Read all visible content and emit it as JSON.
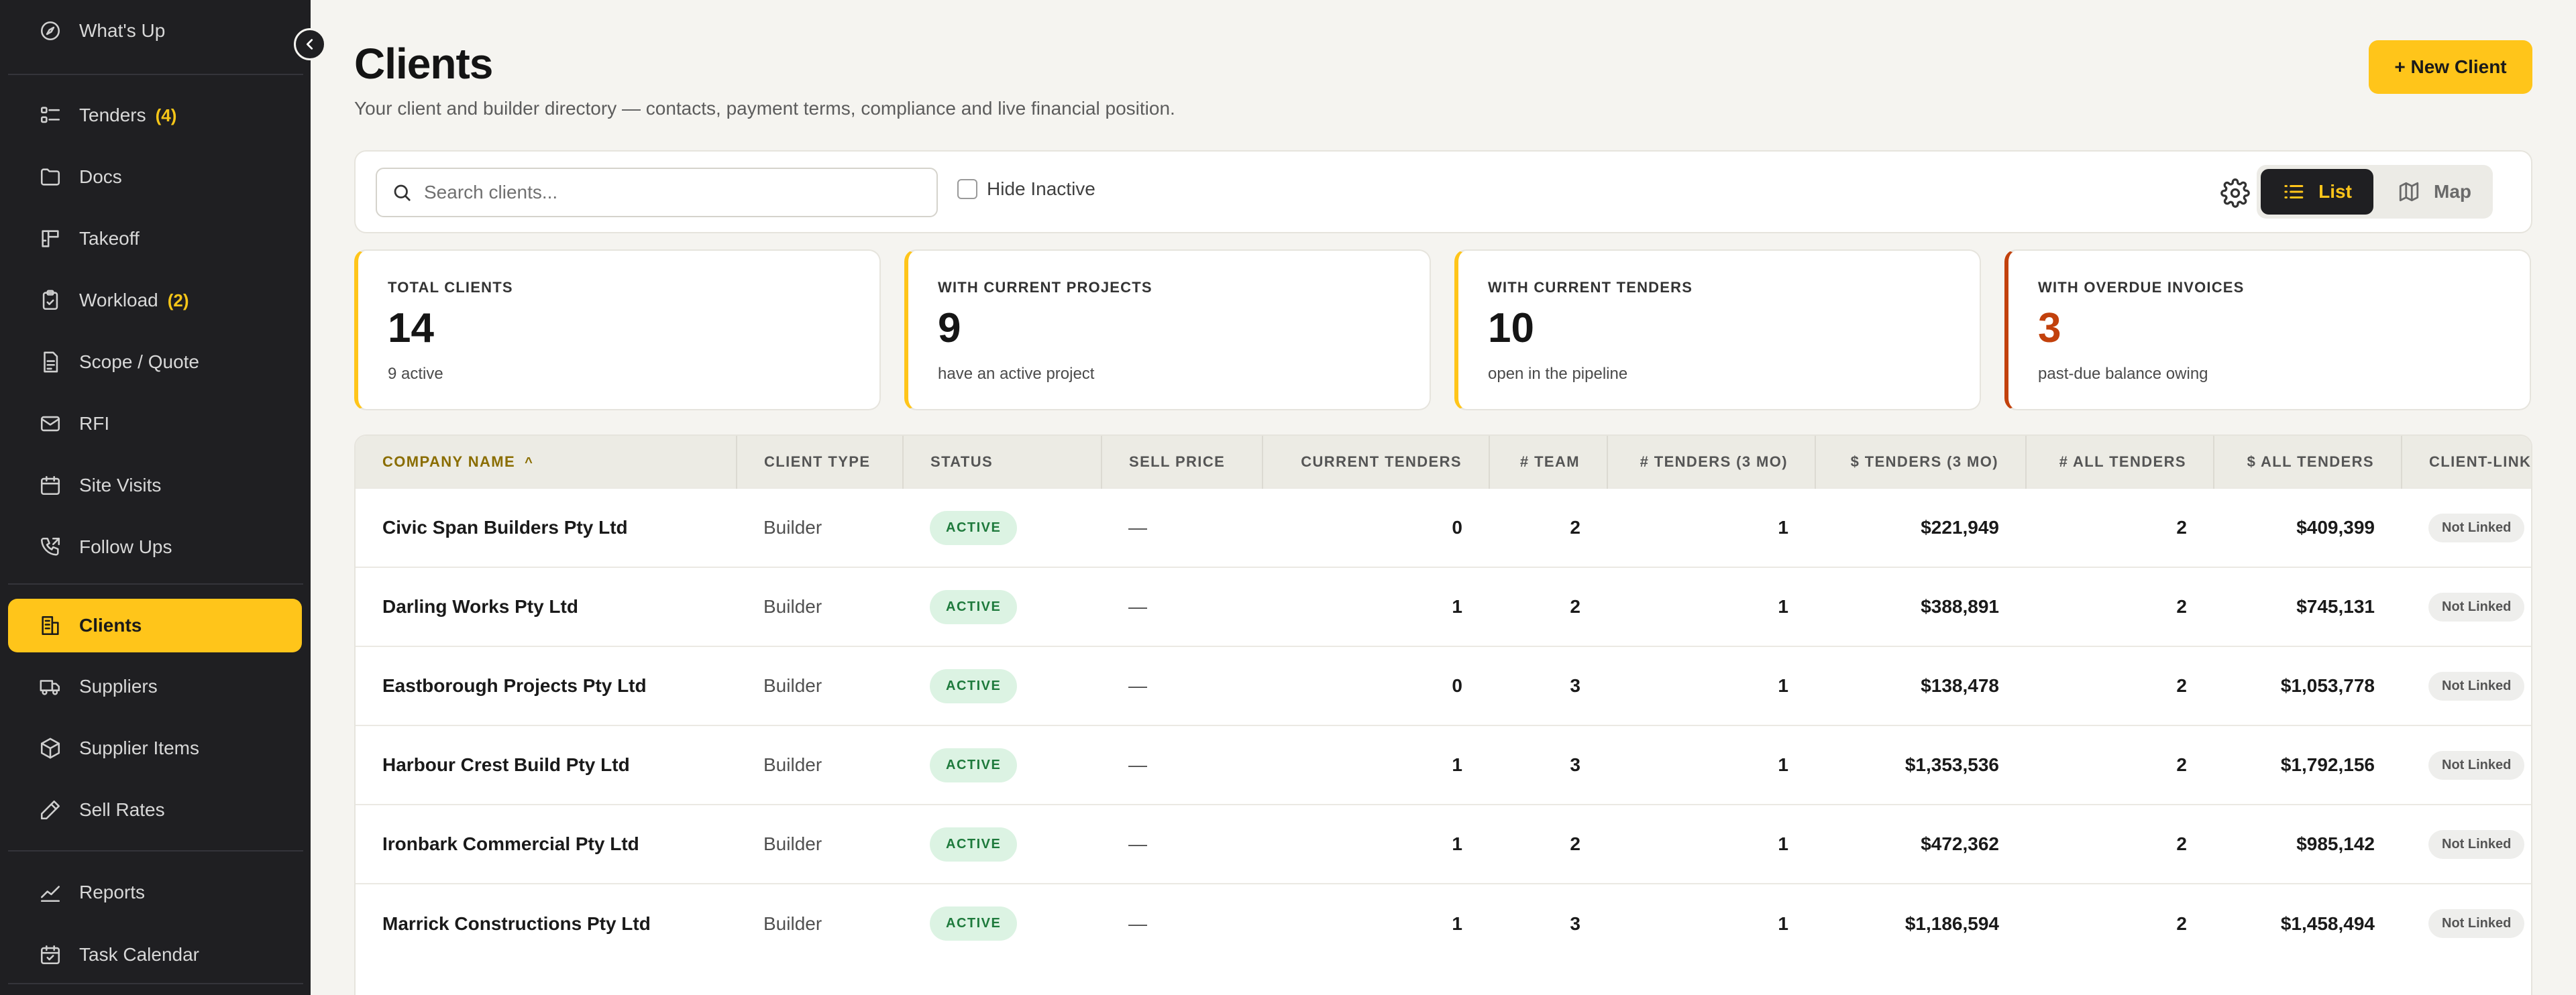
{
  "sidebar": {
    "items": [
      {
        "key": "whats-up",
        "label": "What's Up",
        "badge": "",
        "icon": "compass-icon"
      },
      {
        "key": "tenders",
        "label": "Tenders",
        "badge": "(4)",
        "icon": "list-icon"
      },
      {
        "key": "docs",
        "label": "Docs",
        "badge": "",
        "icon": "folder-icon"
      },
      {
        "key": "takeoff",
        "label": "Takeoff",
        "badge": "",
        "icon": "blueprint-icon"
      },
      {
        "key": "workload",
        "label": "Workload",
        "badge": "(2)",
        "icon": "clipboard-icon"
      },
      {
        "key": "scope-quote",
        "label": "Scope / Quote",
        "badge": "",
        "icon": "document-icon"
      },
      {
        "key": "rfi",
        "label": "RFI",
        "badge": "",
        "icon": "mail-icon"
      },
      {
        "key": "site-visits",
        "label": "Site Visits",
        "badge": "",
        "icon": "calendar-icon"
      },
      {
        "key": "follow-ups",
        "label": "Follow Ups",
        "badge": "",
        "icon": "phone-icon"
      },
      {
        "key": "clients",
        "label": "Clients",
        "badge": "",
        "icon": "building-icon"
      },
      {
        "key": "suppliers",
        "label": "Suppliers",
        "badge": "",
        "icon": "truck-icon"
      },
      {
        "key": "supplier-items",
        "label": "Supplier Items",
        "badge": "",
        "icon": "box-icon"
      },
      {
        "key": "sell-rates",
        "label": "Sell Rates",
        "badge": "",
        "icon": "pencil-icon"
      },
      {
        "key": "reports",
        "label": "Reports",
        "badge": "",
        "icon": "chart-line-icon"
      },
      {
        "key": "task-calendar",
        "label": "Task Calendar",
        "badge": "",
        "icon": "calendar-check-icon"
      }
    ],
    "active": "clients"
  },
  "header": {
    "title": "Clients",
    "subtitle": "Your client and builder directory — contacts, payment terms, compliance and live financial position.",
    "new_button": "+ New Client"
  },
  "toolbar": {
    "search_placeholder": "Search clients...",
    "search_value": "",
    "hide_inactive_label": "Hide Inactive",
    "hide_inactive_checked": false,
    "view_list_label": "List",
    "view_map_label": "Map",
    "active_view": "List"
  },
  "stats": [
    {
      "label": "TOTAL CLIENTS",
      "value": "14",
      "sub": "9 active",
      "tone": "normal"
    },
    {
      "label": "WITH CURRENT PROJECTS",
      "value": "9",
      "sub": "have an active project",
      "tone": "normal"
    },
    {
      "label": "WITH CURRENT TENDERS",
      "value": "10",
      "sub": "open in the pipeline",
      "tone": "normal"
    },
    {
      "label": "WITH OVERDUE INVOICES",
      "value": "3",
      "sub": "past-due balance owing",
      "tone": "danger"
    }
  ],
  "table": {
    "columns": [
      "COMPANY NAME",
      "CLIENT TYPE",
      "STATUS",
      "SELL PRICE",
      "CURRENT TENDERS",
      "# TEAM",
      "# TENDERS (3 MO)",
      "$ TENDERS (3 MO)",
      "# ALL TENDERS",
      "$ ALL TENDERS",
      "CLIENT-LINK"
    ],
    "sort_column": "COMPANY NAME",
    "sort_dir": "asc",
    "rows": [
      {
        "company": "Civic Span Builders Pty Ltd",
        "type": "Builder",
        "status": "ACTIVE",
        "sell_price": "—",
        "current_tenders": "0",
        "team": "2",
        "tenders_3mo": "1",
        "tenders_3mo_value": "$221,949",
        "all_tenders": "2",
        "all_tenders_value": "$409,399",
        "link": "Not Linked"
      },
      {
        "company": "Darling Works Pty Ltd",
        "type": "Builder",
        "status": "ACTIVE",
        "sell_price": "—",
        "current_tenders": "1",
        "team": "2",
        "tenders_3mo": "1",
        "tenders_3mo_value": "$388,891",
        "all_tenders": "2",
        "all_tenders_value": "$745,131",
        "link": "Not Linked"
      },
      {
        "company": "Eastborough Projects Pty Ltd",
        "type": "Builder",
        "status": "ACTIVE",
        "sell_price": "—",
        "current_tenders": "0",
        "team": "3",
        "tenders_3mo": "1",
        "tenders_3mo_value": "$138,478",
        "all_tenders": "2",
        "all_tenders_value": "$1,053,778",
        "link": "Not Linked"
      },
      {
        "company": "Harbour Crest Build Pty Ltd",
        "type": "Builder",
        "status": "ACTIVE",
        "sell_price": "—",
        "current_tenders": "1",
        "team": "3",
        "tenders_3mo": "1",
        "tenders_3mo_value": "$1,353,536",
        "all_tenders": "2",
        "all_tenders_value": "$1,792,156",
        "link": "Not Linked"
      },
      {
        "company": "Ironbark Commercial Pty Ltd",
        "type": "Builder",
        "status": "ACTIVE",
        "sell_price": "—",
        "current_tenders": "1",
        "team": "2",
        "tenders_3mo": "1",
        "tenders_3mo_value": "$472,362",
        "all_tenders": "2",
        "all_tenders_value": "$985,142",
        "link": "Not Linked"
      },
      {
        "company": "Marrick Constructions Pty Ltd",
        "type": "Builder",
        "status": "ACTIVE",
        "sell_price": "—",
        "current_tenders": "1",
        "team": "3",
        "tenders_3mo": "1",
        "tenders_3mo_value": "$1,186,594",
        "all_tenders": "2",
        "all_tenders_value": "$1,458,494",
        "link": "Not Linked"
      }
    ]
  },
  "colors": {
    "accent": "#ffc51a",
    "sidebar_bg": "#1f1f22",
    "danger": "#c2410c",
    "active_green": "#1e7a3c"
  }
}
